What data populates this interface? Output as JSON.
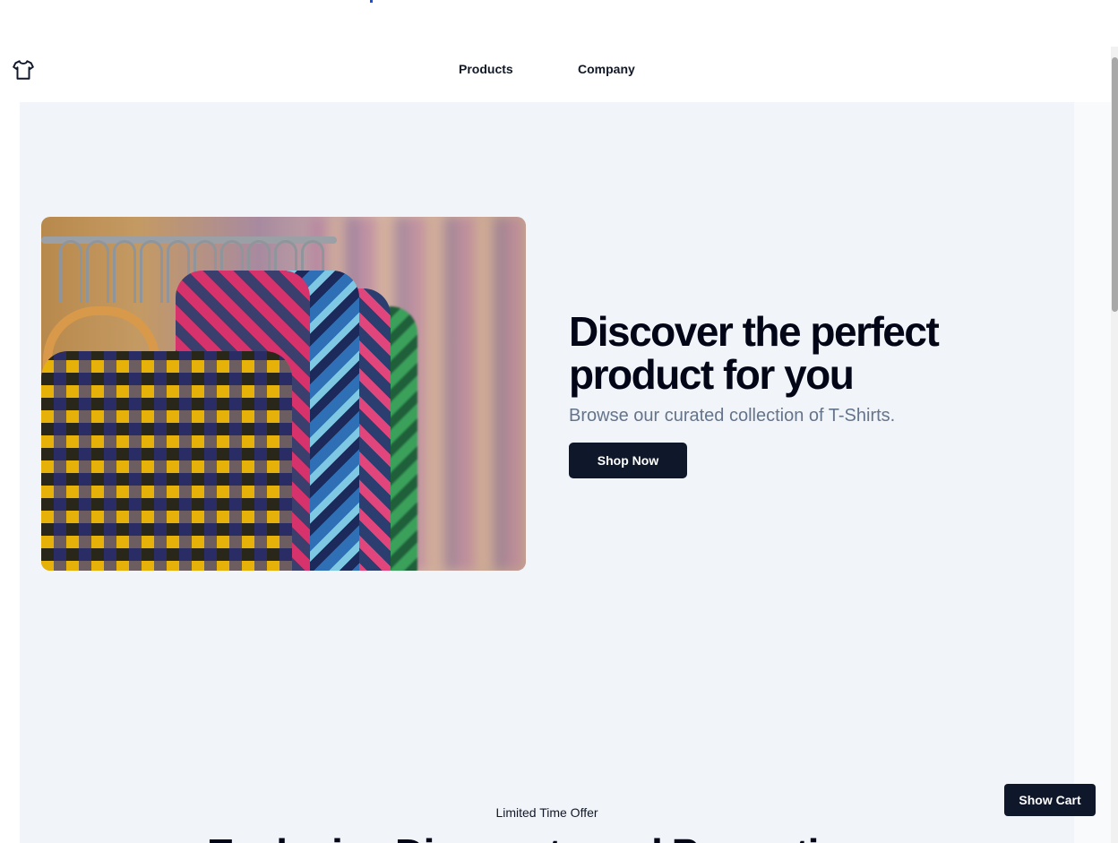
{
  "header": {
    "logo_icon": "tshirt-icon",
    "nav": [
      {
        "label": "Products"
      },
      {
        "label": "Company"
      }
    ]
  },
  "hero": {
    "image_subject": "Rack of checkered shirts on hangers",
    "title": "Discover the perfect product for you",
    "subtitle": "Browse our curated collection of T-Shirts.",
    "cta_label": "Shop Now"
  },
  "offer": {
    "label": "Limited Time Offer",
    "heading": "Exclusive Discounts and Promotions"
  },
  "cart": {
    "button_label": "Show Cart"
  },
  "colors": {
    "primary": "#0f172a",
    "background": "#f1f4f9",
    "muted_text": "#64748b"
  }
}
